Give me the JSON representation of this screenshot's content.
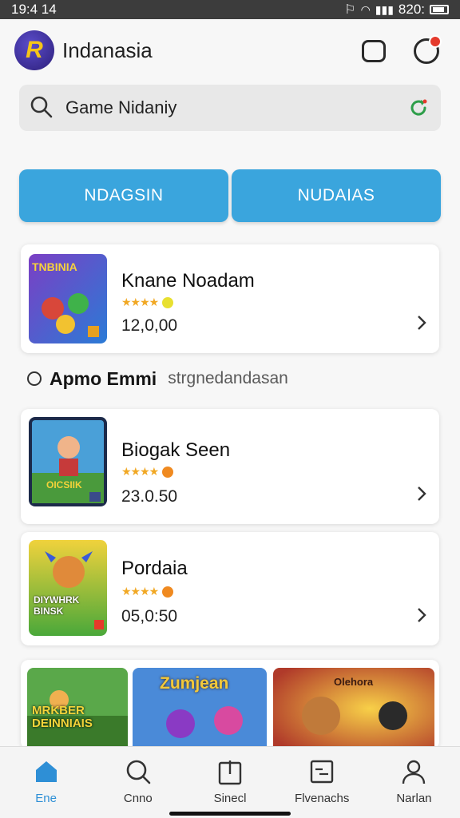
{
  "status": {
    "time": "19:4 14",
    "battery": "820:"
  },
  "app": {
    "logo_letter": "R",
    "title": "Indanasia"
  },
  "search": {
    "value": "Game Nidaniy"
  },
  "tabs": [
    {
      "label": "NDAGSIN"
    },
    {
      "label": "NUDAIAS"
    }
  ],
  "cards": [
    {
      "title": "Knane Noadam",
      "price": "12,0,00",
      "thumb_text": "TNBINIA"
    },
    {
      "title": "Biogak Seen",
      "price": "23.0.50",
      "thumb_text": "OICSIIK"
    },
    {
      "title": "Pordaia",
      "price": "05,0:50",
      "thumb_text": "DIYWHRK BINSK"
    }
  ],
  "section": {
    "title": "Apmo Emmi",
    "subtitle": "strgnedandasan"
  },
  "banners": [
    {
      "label": "MRKBER DEINNIAIS"
    },
    {
      "label": "Zumjean"
    },
    {
      "label": "Olehora"
    }
  ],
  "nav": [
    {
      "label": "Ene",
      "icon": "home-icon"
    },
    {
      "label": "Cnno",
      "icon": "search-icon"
    },
    {
      "label": "Sinecl",
      "icon": "gift-icon"
    },
    {
      "label": "Flvenachs",
      "icon": "clipboard-icon"
    },
    {
      "label": "Narlan",
      "icon": "person-icon"
    }
  ],
  "colors": {
    "accent": "#3aa5dd",
    "active_nav": "#2e8fd6",
    "notification": "#e53a2c",
    "star": "#f1a824"
  }
}
